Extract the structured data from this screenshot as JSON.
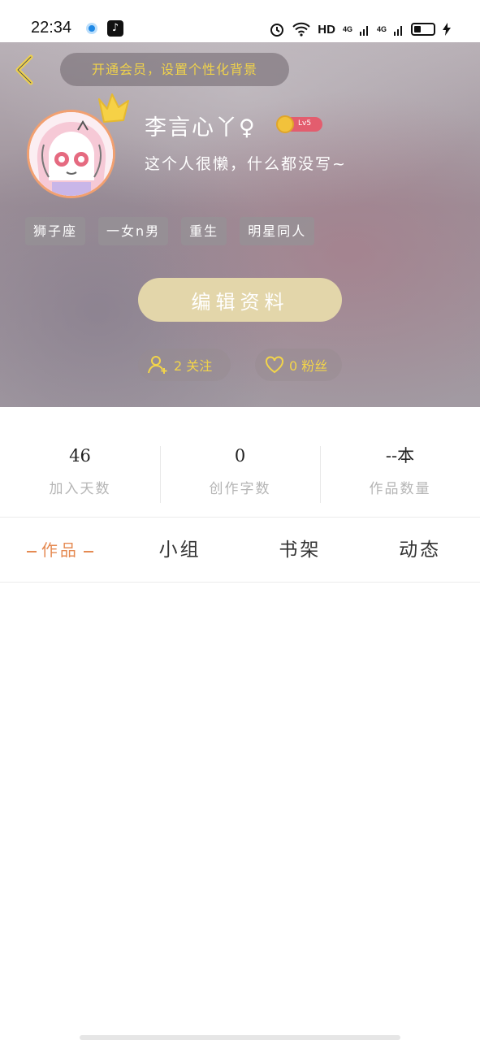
{
  "status_bar": {
    "time": "22:34",
    "network_label": "HD",
    "signal_1": "4G",
    "signal_2": "4G"
  },
  "header": {
    "vip_banner": "开通会员，设置个性化背景",
    "username": "李言心丫♀",
    "level": "Lv5",
    "bio": "这个人很懒，什么都没写~",
    "tags": [
      "狮子座",
      "一女n男",
      "重生",
      "明星同人"
    ],
    "edit_button": "编辑资料",
    "following": "2 关注",
    "fans": "0 粉丝"
  },
  "stats": [
    {
      "value": "46",
      "label": "加入天数"
    },
    {
      "value": "0",
      "label": "创作字数"
    },
    {
      "value": "--本",
      "label": "作品数量"
    }
  ],
  "tabs": [
    "作品",
    "小组",
    "书架",
    "动态"
  ],
  "colors": {
    "accent": "#e58a52",
    "gold_text": "#f0d24a",
    "edit_button": "#e3d6aa"
  },
  "icons": {
    "back": "chevron-left-icon",
    "crown": "crown-icon",
    "follow": "user-add-icon",
    "fans": "heart-icon",
    "level_coin": "coin-icon"
  }
}
